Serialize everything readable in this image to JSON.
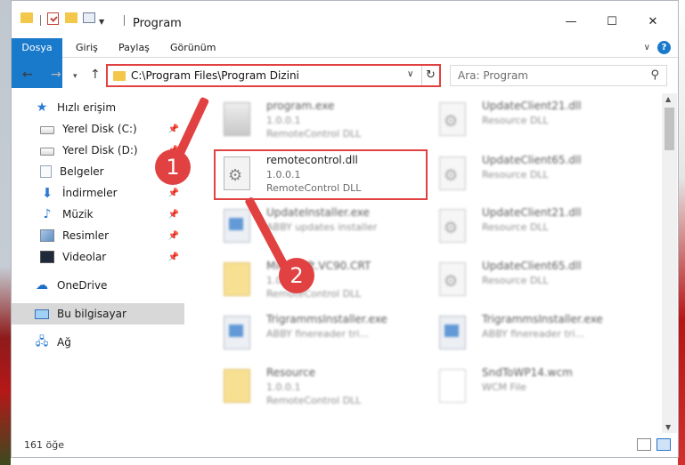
{
  "window": {
    "title": "Program"
  },
  "window_controls": {
    "minimize": "—",
    "maximize": "☐",
    "close": "✕"
  },
  "ribbon": {
    "tabs": [
      "Dosya",
      "Giriş",
      "Paylaş",
      "Görünüm"
    ],
    "help": "?"
  },
  "nav": {
    "back": "←",
    "forward": "→",
    "recent": "▾",
    "up": "↑",
    "address": "C:\\Program Files\\Program Dizini",
    "address_dropdown": "∨",
    "refresh": "↻",
    "search_placeholder": "Ara: Program"
  },
  "sidebar": {
    "items": [
      {
        "label": "Hızlı erişim",
        "icon": "star-icon"
      },
      {
        "label": "Yerel Disk (C:)",
        "icon": "drive-icon",
        "pin": true
      },
      {
        "label": "Yerel Disk (D:)",
        "icon": "drive-icon",
        "pin": true
      },
      {
        "label": "Belgeler",
        "icon": "documents-icon",
        "pin": true
      },
      {
        "label": "İndirmeler",
        "icon": "download-icon",
        "pin": true
      },
      {
        "label": "Müzik",
        "icon": "music-icon",
        "pin": true
      },
      {
        "label": "Resimler",
        "icon": "pictures-icon",
        "pin": true
      },
      {
        "label": "Videolar",
        "icon": "videos-icon",
        "pin": true
      },
      {
        "label": "OneDrive",
        "icon": "cloud-icon"
      },
      {
        "label": "Bu bilgisayar",
        "icon": "computer-icon",
        "selected": true
      },
      {
        "label": "Ağ",
        "icon": "network-icon"
      }
    ]
  },
  "files": [
    {
      "name": "program.exe",
      "version": "1.0.0.1",
      "desc": "RemoteControl DLL",
      "icon": "program-icon",
      "blurred": true
    },
    {
      "name": "UpdateClient21.dll",
      "version": "",
      "desc": "Resource DLL",
      "icon": "dll-icon",
      "blurred": true
    },
    {
      "name": "remotecontrol.dll",
      "version": "1.0.0.1",
      "desc": "RemoteControl DLL",
      "icon": "dll-icon",
      "blurred": false
    },
    {
      "name": "UpdateClient65.dll",
      "version": "",
      "desc": "Resource DLL",
      "icon": "dll-icon",
      "blurred": true
    },
    {
      "name": "UpdateInstaller.exe",
      "version": "",
      "desc": "ABBY updates installer",
      "icon": "exe-icon",
      "blurred": true
    },
    {
      "name": "UpdateClient21.dll",
      "version": "",
      "desc": "Resource DLL",
      "icon": "dll-icon",
      "blurred": true
    },
    {
      "name": "Microsoft.VC90.CRT",
      "version": "1.0.0.1",
      "desc": "RemoteControl DLL",
      "icon": "folder-icon",
      "blurred": true
    },
    {
      "name": "UpdateClient65.dll",
      "version": "",
      "desc": "Resource DLL",
      "icon": "dll-icon",
      "blurred": true
    },
    {
      "name": "TrigrammsInstaller.exe",
      "version": "",
      "desc": "ABBY finereader tri...",
      "icon": "exe-icon",
      "blurred": true
    },
    {
      "name": "TrigrammsInstaller.exe",
      "version": "",
      "desc": "ABBY finereader tri...",
      "icon": "exe-icon",
      "blurred": true
    },
    {
      "name": "Resource",
      "version": "1.0.0.1",
      "desc": "RemoteControl DLL",
      "icon": "folder-icon",
      "blurred": true
    },
    {
      "name": "SndToWP14.wcm",
      "version": "",
      "desc": "WCM File",
      "icon": "file-icon",
      "blurred": true
    }
  ],
  "status": {
    "count": "161 öğe"
  },
  "annotations": {
    "step1": "1",
    "step2": "2",
    "color": "#e14141"
  }
}
